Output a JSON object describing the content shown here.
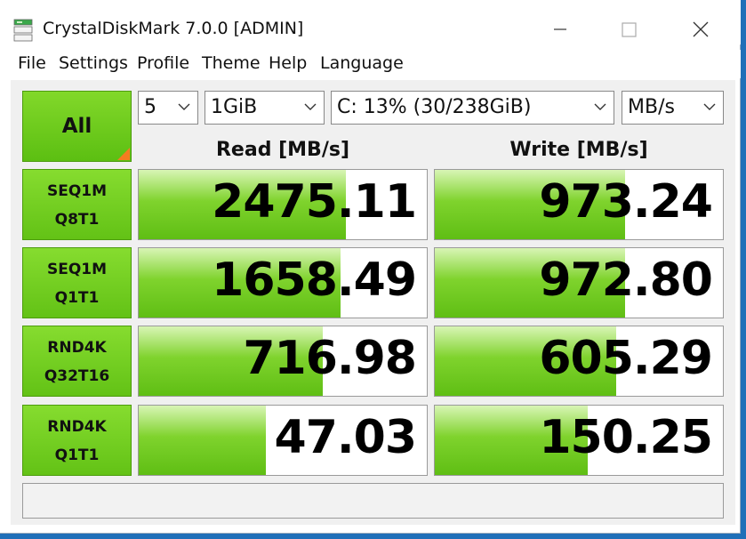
{
  "window": {
    "title": "CrystalDiskMark 7.0.0  [ADMIN]"
  },
  "menu": [
    "File",
    "Settings",
    "Profile",
    "Theme",
    "Help",
    "Language"
  ],
  "controls": {
    "all_label": "All",
    "count": "5",
    "size": "1GiB",
    "drive": "C: 13% (30/238GiB)",
    "unit": "MB/s"
  },
  "headers": {
    "read": "Read [MB/s]",
    "write": "Write [MB/s]"
  },
  "tests": [
    {
      "line1": "SEQ1M",
      "line2": "Q8T1",
      "read": "2475.11",
      "write": "973.24",
      "read_level": 0.72,
      "write_level": 0.66
    },
    {
      "line1": "SEQ1M",
      "line2": "Q1T1",
      "read": "1658.49",
      "write": "972.80",
      "read_level": 0.7,
      "write_level": 0.66
    },
    {
      "line1": "RND4K",
      "line2": "Q32T16",
      "read": "716.98",
      "write": "605.29",
      "read_level": 0.64,
      "write_level": 0.63
    },
    {
      "line1": "RND4K",
      "line2": "Q1T1",
      "read": "47.03",
      "write": "150.25",
      "read_level": 0.44,
      "write_level": 0.53
    }
  ],
  "status_text": "",
  "colors": {
    "accent_green": "#62c214",
    "corner_orange": "#f47c20",
    "desktop_blue": "#1f6fb8"
  }
}
